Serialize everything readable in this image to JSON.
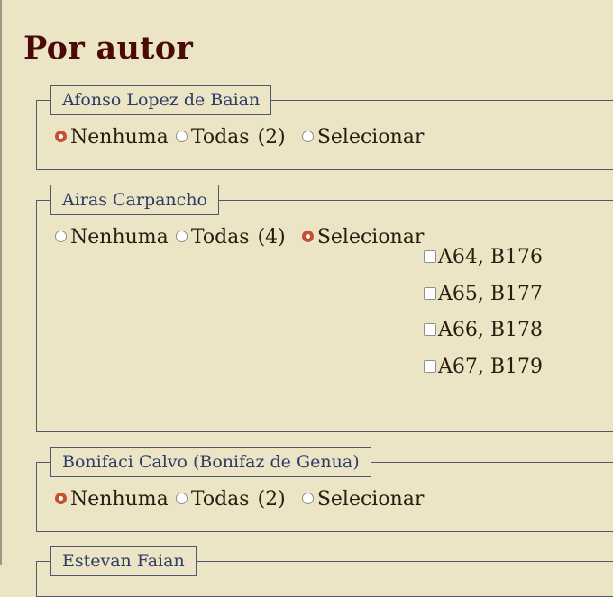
{
  "page": {
    "title": "Por autor"
  },
  "option_labels": {
    "none": "Nenhuma",
    "all": "Todas",
    "select": "Selecionar"
  },
  "authors": [
    {
      "name": "Afonso Lopez de Baian",
      "count": "(2)",
      "selected": "none",
      "items": []
    },
    {
      "name": "Airas Carpancho",
      "count": "(4)",
      "selected": "select",
      "items": [
        "A64, B176",
        "A65, B177",
        "A66, B178",
        "A67, B179"
      ]
    },
    {
      "name": "Bonifaci Calvo (Bonifaz de Genua)",
      "count": "(2)",
      "selected": "none",
      "items": []
    },
    {
      "name": "Estevan Faian",
      "count": "",
      "selected": "",
      "items": []
    }
  ],
  "colors": {
    "accent": "#c94f30",
    "title": "#4a0a08",
    "legend": "#2e3d66",
    "background": "#ebe4c5"
  }
}
